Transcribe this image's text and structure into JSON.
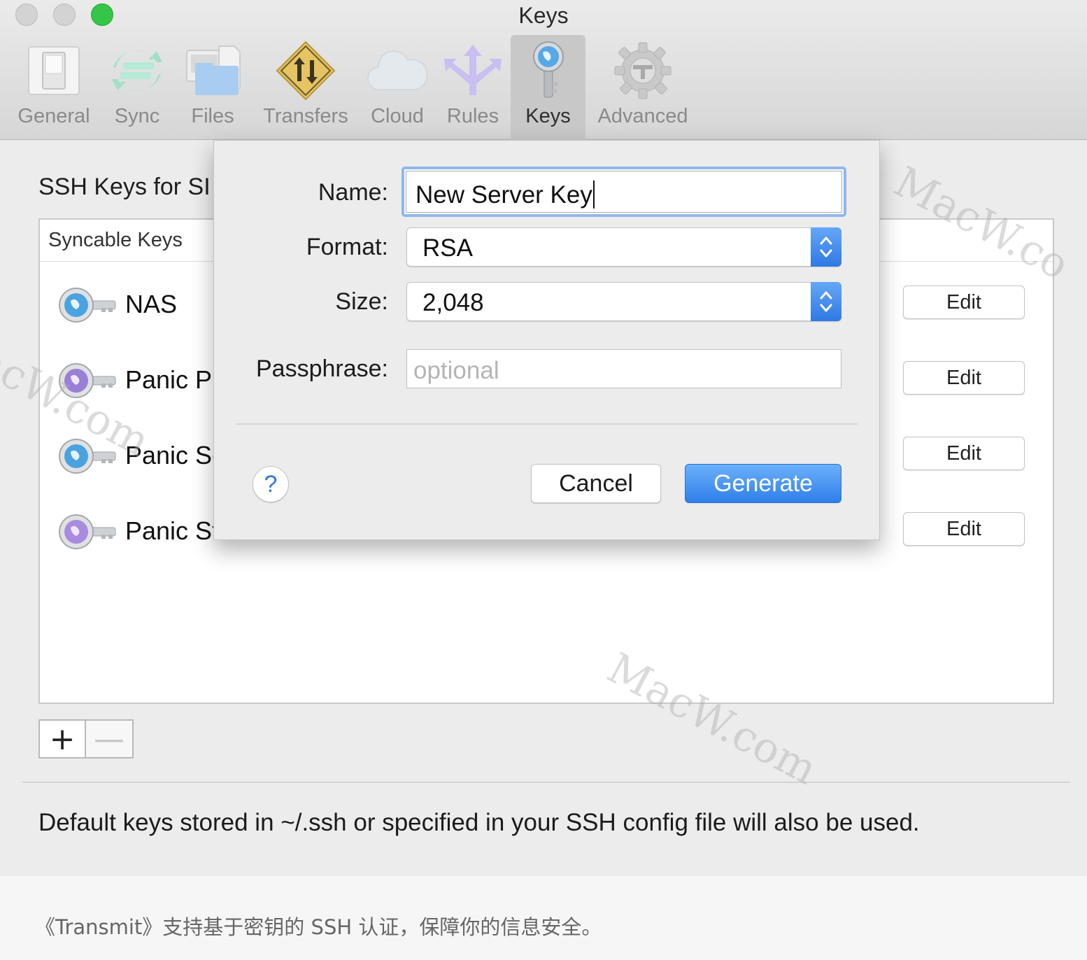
{
  "window": {
    "title": "Keys"
  },
  "toolbar": {
    "items": [
      {
        "label": "General",
        "icon": "general-switch-icon"
      },
      {
        "label": "Sync",
        "icon": "sync-arrows-icon"
      },
      {
        "label": "Files",
        "icon": "files-icon"
      },
      {
        "label": "Transfers",
        "icon": "transfers-sign-icon"
      },
      {
        "label": "Cloud",
        "icon": "cloud-icon"
      },
      {
        "label": "Rules",
        "icon": "rules-arrows-icon"
      },
      {
        "label": "Keys",
        "icon": "key-globe-icon",
        "selected": true
      },
      {
        "label": "Advanced",
        "icon": "gear-icon"
      }
    ]
  },
  "main": {
    "section_title": "SSH Keys for SI",
    "list_header": "Syncable Keys",
    "keys": [
      {
        "name": "NAS",
        "icon_color": "#4aa3e0",
        "edit_label": "Edit"
      },
      {
        "name": "Panic Pr",
        "icon_color": "#9a7fd6",
        "edit_label": "Edit"
      },
      {
        "name": "Panic Se",
        "icon_color": "#4aa3e0",
        "edit_label": "Edit"
      },
      {
        "name": "Panic St",
        "icon_color": "#a98be0",
        "edit_label": "Edit"
      }
    ],
    "add_label": "+",
    "remove_label": "—",
    "footer_note": "Default keys stored in ~/.ssh or specified in your SSH config file will also be used."
  },
  "sheet": {
    "name_label": "Name:",
    "name_value": "New Server Key",
    "format_label": "Format:",
    "format_value": "RSA",
    "size_label": "Size:",
    "size_value": "2,048",
    "passphrase_label": "Passphrase:",
    "passphrase_placeholder": "optional",
    "help_label": "?",
    "cancel_label": "Cancel",
    "generate_label": "Generate"
  },
  "caption": "《Transmit》支持基于密钥的 SSH 认证，保障你的信息安全。",
  "watermarks": [
    "MacW.co",
    "acW.com",
    "MacW.com"
  ],
  "colors": {
    "accent": "#2f7fea",
    "focus_ring": "#8fb8ec",
    "zoom_button": "#35c648"
  }
}
